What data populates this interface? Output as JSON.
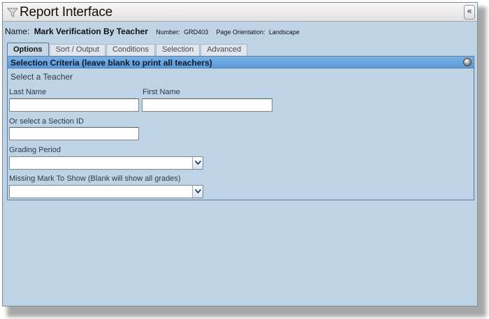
{
  "window": {
    "title": "Report Interface",
    "collapse_glyph": "«"
  },
  "report": {
    "name_label": "Name:",
    "name": "Mark Verification By Teacher",
    "number_label": "Number:",
    "number": "GRD403",
    "orientation_label": "Page Orientation:",
    "orientation": "Landscape"
  },
  "tabs": [
    {
      "label": "Options",
      "active": true
    },
    {
      "label": "Sort / Output",
      "active": false
    },
    {
      "label": "Conditions",
      "active": false
    },
    {
      "label": "Selection",
      "active": false
    },
    {
      "label": "Advanced",
      "active": false
    }
  ],
  "criteria": {
    "header": "Selection Criteria (leave blank to print all teachers)",
    "teacher_heading": "Select a Teacher",
    "last_name": {
      "label": "Last Name",
      "value": ""
    },
    "first_name": {
      "label": "First Name",
      "value": ""
    },
    "section": {
      "label": "Or select a Section ID",
      "value": ""
    },
    "grading_period": {
      "label": "Grading Period",
      "value": ""
    },
    "missing_mark": {
      "label": "Missing Mark To Show (Blank will show all grades)",
      "value": ""
    }
  },
  "icons": {
    "title": "funnel-icon",
    "collapse": "double-chevron-left-icon",
    "panel": "globe-icon",
    "dropdown": "chevron-down-icon"
  },
  "colors": {
    "window_bg": "#bfd3e6",
    "panel_header": "#6ba6df",
    "border": "#5d7a96"
  }
}
